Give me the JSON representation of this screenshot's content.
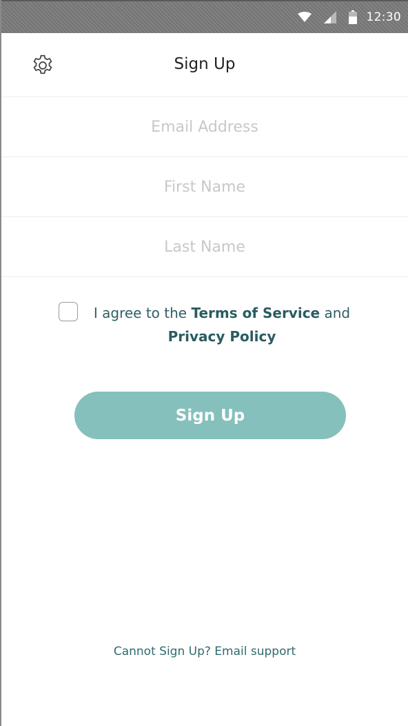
{
  "status_bar": {
    "time": "12:30",
    "icons": [
      "wifi-icon",
      "signal-icon",
      "battery-icon"
    ]
  },
  "header": {
    "title": "Sign Up",
    "settings_icon": "gear-icon"
  },
  "form": {
    "email_placeholder": "Email Address",
    "email_value": "",
    "first_name_placeholder": "First Name",
    "first_name_value": "",
    "last_name_placeholder": "Last Name",
    "last_name_value": ""
  },
  "agreement": {
    "prefix": "I agree to the ",
    "terms_label": "Terms of Service",
    "conjunction": " and",
    "privacy_label": "Privacy Policy",
    "checked": false
  },
  "signup_button_label": "Sign Up",
  "support_link": "Cannot Sign Up? Email support",
  "colors": {
    "accent": "#85c0bc",
    "link_text": "#2a5c60",
    "status_bar": "#7b7b7b"
  }
}
